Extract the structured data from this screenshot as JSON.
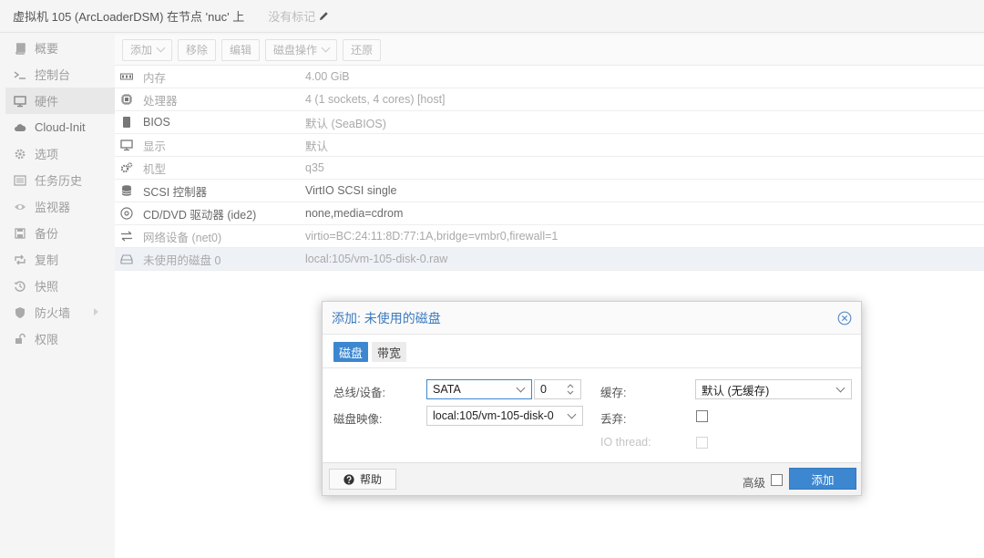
{
  "header": {
    "title": "虚拟机 105 (ArcLoaderDSM) 在节点 'nuc' 上",
    "tags_label": "没有标记"
  },
  "sidebar": {
    "items": [
      {
        "label": "概要",
        "icon": "book-icon"
      },
      {
        "label": "控制台",
        "icon": "terminal-icon"
      },
      {
        "label": "硬件",
        "icon": "monitor-icon",
        "active": true
      },
      {
        "label": "Cloud-Init",
        "icon": "cloud-icon"
      },
      {
        "label": "选项",
        "icon": "gear-icon"
      },
      {
        "label": "任务历史",
        "icon": "list-icon"
      },
      {
        "label": "监视器",
        "icon": "eye-icon"
      },
      {
        "label": "备份",
        "icon": "floppy-icon"
      },
      {
        "label": "复制",
        "icon": "retweet-icon"
      },
      {
        "label": "快照",
        "icon": "history-icon"
      },
      {
        "label": "防火墙",
        "icon": "shield-icon"
      },
      {
        "label": "权限",
        "icon": "unlock-icon"
      }
    ]
  },
  "toolbar": {
    "add_label": "添加",
    "remove_label": "移除",
    "edit_label": "编辑",
    "disk_action_label": "磁盘操作",
    "revert_label": "还原"
  },
  "hardware": [
    {
      "name": "内存",
      "value": "4.00 GiB",
      "icon": "memory-icon"
    },
    {
      "name": "处理器",
      "value": "4 (1 sockets, 4 cores) [host]",
      "icon": "cpu-icon"
    },
    {
      "name": "BIOS",
      "value": "默认 (SeaBIOS)",
      "icon": "bios-icon"
    },
    {
      "name": "显示",
      "value": "默认",
      "icon": "display-icon"
    },
    {
      "name": "机型",
      "value": "q35",
      "icon": "cogs-icon"
    },
    {
      "name": "SCSI 控制器",
      "value": "VirtIO SCSI single",
      "icon": "database-icon"
    },
    {
      "name": "CD/DVD 驱动器 (ide2)",
      "value": "none,media=cdrom",
      "icon": "cdrom-icon"
    },
    {
      "name": "网络设备 (net0)",
      "value": "virtio=BC:24:11:8D:77:1A,bridge=vmbr0,firewall=1",
      "icon": "exchange-icon"
    },
    {
      "name": "未使用的磁盘 0",
      "value": "local:105/vm-105-disk-0.raw",
      "icon": "hdd-icon"
    }
  ],
  "dialog": {
    "title": "添加: 未使用的磁盘",
    "tabs": {
      "disk": "磁盘",
      "bandwidth": "带宽"
    },
    "bus_label": "总线/设备:",
    "bus_value": "SATA",
    "device_num": "0",
    "image_label": "磁盘映像:",
    "image_value": "local:105/vm-105-disk-0",
    "cache_label": "缓存:",
    "cache_value": "默认 (无缓存)",
    "discard_label": "丢弃:",
    "io_thread_label": "IO thread:",
    "help_label": "帮助",
    "advanced_label": "高级",
    "add_label": "添加"
  }
}
